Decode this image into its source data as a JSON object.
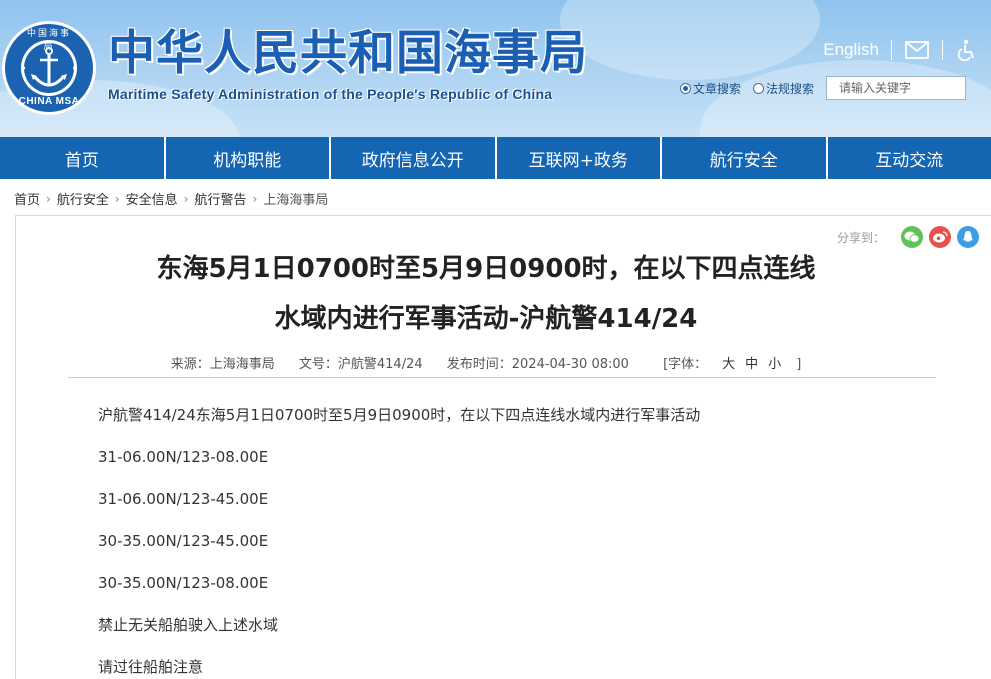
{
  "header": {
    "title": "中华人民共和国海事局",
    "subtitle": "Maritime Safety Administration of the People's Republic of China",
    "english_link": "English",
    "logo_text_top": "中国海事局",
    "logo_text_bottom": "CHINA MSA",
    "search": {
      "option_article": "文章搜索",
      "option_law": "法规搜索",
      "selected": "文章搜索",
      "placeholder": "请输入关键字"
    }
  },
  "nav": {
    "items": [
      "首页",
      "机构职能",
      "政府信息公开",
      "互联网+政务",
      "航行安全",
      "互动交流"
    ]
  },
  "breadcrumb": [
    "首页",
    "航行安全",
    "安全信息",
    "航行警告",
    "上海海事局"
  ],
  "article": {
    "share_label": "分享到：",
    "title_line1": "东海5月1日0700时至5月9日0900时，在以下四点连线",
    "title_line2": "水域内进行军事活动-沪航警414/24",
    "meta": {
      "source": "来源：上海海事局",
      "doc_no": "文号：沪航警414/24",
      "publish_time": "发布时间：2024-04-30 08:00",
      "font_label_open": "[字体：",
      "font_large": "大",
      "font_medium": "中",
      "font_small": "小",
      "font_label_close": "]"
    },
    "paragraphs": [
      "沪航警414/24东海5月1日0700时至5月9日0900时，在以下四点连线水域内进行军事活动",
      "31-06.00N/123-08.00E",
      "31-06.00N/123-45.00E",
      "30-35.00N/123-45.00E",
      "30-35.00N/123-08.00E",
      "禁止无关船舶驶入上述水域",
      "请过往船舶注意"
    ]
  },
  "colors": {
    "nav_bg": "#1466b3",
    "title_blue": "#1a5fb4",
    "wechat": "#5fc25a",
    "weibo": "#e9524b",
    "qq": "#3d9ee8"
  }
}
